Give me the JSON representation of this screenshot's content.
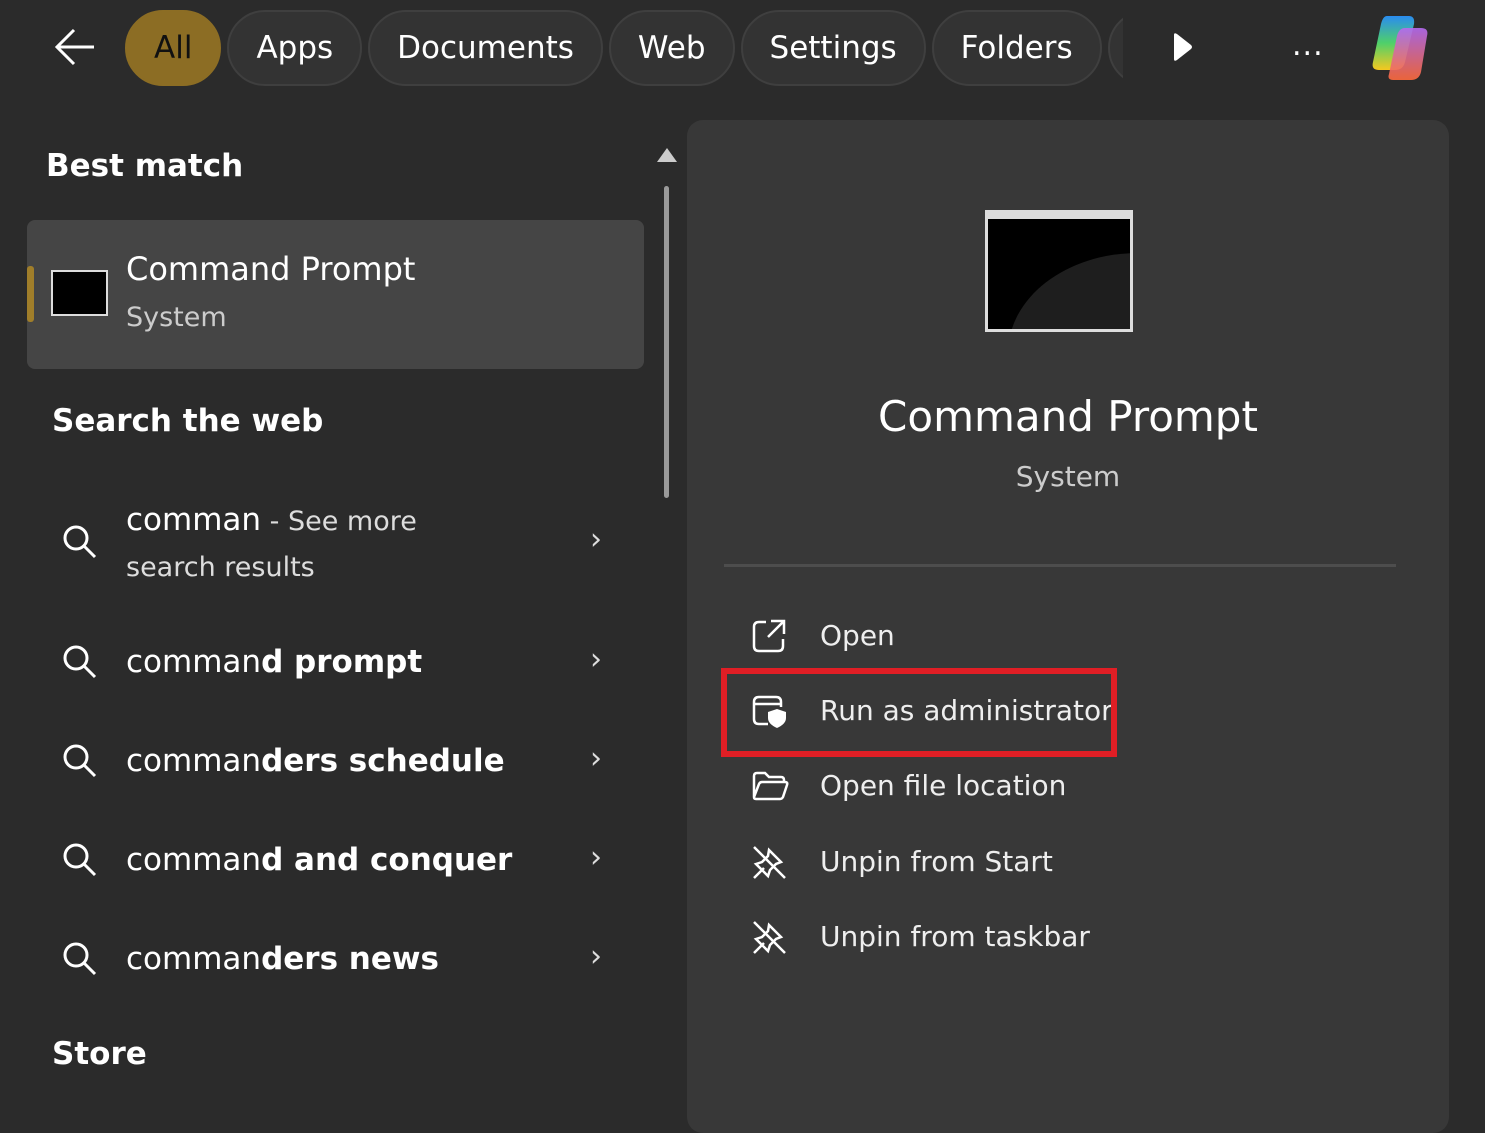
{
  "filters": {
    "back": "back-icon",
    "tabs": [
      "All",
      "Apps",
      "Documents",
      "Web",
      "Settings",
      "Folders"
    ],
    "active": "All",
    "more": "..."
  },
  "left": {
    "best_match_heading": "Best match",
    "best_match": {
      "title": "Command Prompt",
      "subtitle": "System"
    },
    "web_heading": "Search the web",
    "web_results": [
      {
        "typed": "comman",
        "suffix": " - See more",
        "line2": "search results"
      },
      {
        "typed": "comman",
        "suffix": "d prompt"
      },
      {
        "typed": "comman",
        "suffix": "ders schedule"
      },
      {
        "typed": "comman",
        "suffix": "d and conquer"
      },
      {
        "typed": "comman",
        "suffix": "ders news"
      }
    ],
    "store_heading": "Store"
  },
  "right": {
    "title": "Command Prompt",
    "subtitle": "System",
    "actions": [
      {
        "label": "Open",
        "icon": "open-external-icon"
      },
      {
        "label": "Run as administrator",
        "icon": "shield-window-icon",
        "highlighted": true
      },
      {
        "label": "Open file location",
        "icon": "folder-icon"
      },
      {
        "label": "Unpin from Start",
        "icon": "unpin-icon"
      },
      {
        "label": "Unpin from taskbar",
        "icon": "unpin-icon"
      }
    ]
  },
  "colors": {
    "accent": "#8c6d24",
    "highlight": "#e01e25",
    "panel": "#383838",
    "background": "#2b2b2b"
  }
}
